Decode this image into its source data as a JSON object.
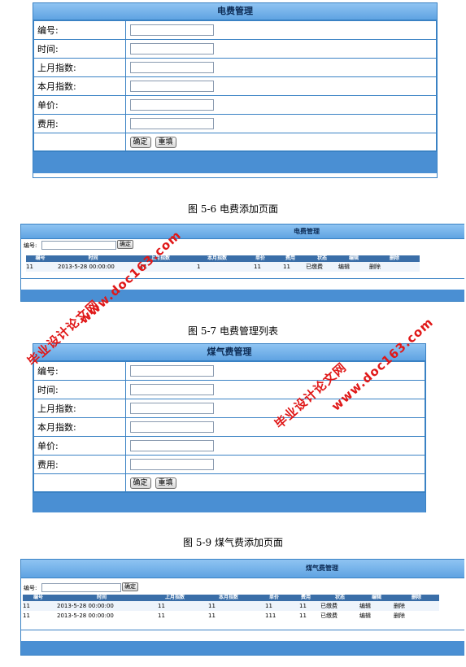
{
  "form1": {
    "title": "电费管理",
    "fields": [
      "编号:",
      "时间:",
      "上月指数:",
      "本月指数:",
      "单价:",
      "费用:"
    ],
    "confirm": "确定",
    "reset": "重填"
  },
  "caption1": "图 5-6 电费添加页面",
  "list1": {
    "title": "电费管理",
    "search_label": "编号:",
    "search_button": "确定",
    "columns": [
      "编号",
      "时间",
      "上月指数",
      "本月指数",
      "单价",
      "费用",
      "状态",
      "编辑",
      "删除"
    ],
    "rows": [
      [
        "11",
        "2013-5-28 00:00:00",
        "11",
        "1",
        "11",
        "11",
        "已缴费",
        "编辑",
        "删除"
      ]
    ]
  },
  "caption2": "图 5-7 电费管理列表",
  "form2": {
    "title": "煤气费管理",
    "fields": [
      "编号:",
      "时间:",
      "上月指数:",
      "本月指数:",
      "单价:",
      "费用:"
    ],
    "confirm": "确定",
    "reset": "重填"
  },
  "caption3": "图 5-9 煤气费添加页面",
  "list2": {
    "title": "煤气费管理",
    "search_label": "编号:",
    "search_button": "确定",
    "columns": [
      "编号",
      "时间",
      "上月指数",
      "本月指数",
      "单价",
      "费用",
      "状态",
      "编辑",
      "删除"
    ],
    "rows": [
      [
        "11",
        "2013-5-28 00:00:00",
        "11",
        "11",
        "11",
        "11",
        "已缴费",
        "编辑",
        "删除"
      ],
      [
        "11",
        "2013-5-28 00:00:00",
        "11",
        "11",
        "111",
        "11",
        "已缴费",
        "编辑",
        "删除"
      ]
    ]
  },
  "watermarks": {
    "brand": "毕业设计论文网",
    "url": "www.doc163.com",
    "color": "#e01818"
  }
}
